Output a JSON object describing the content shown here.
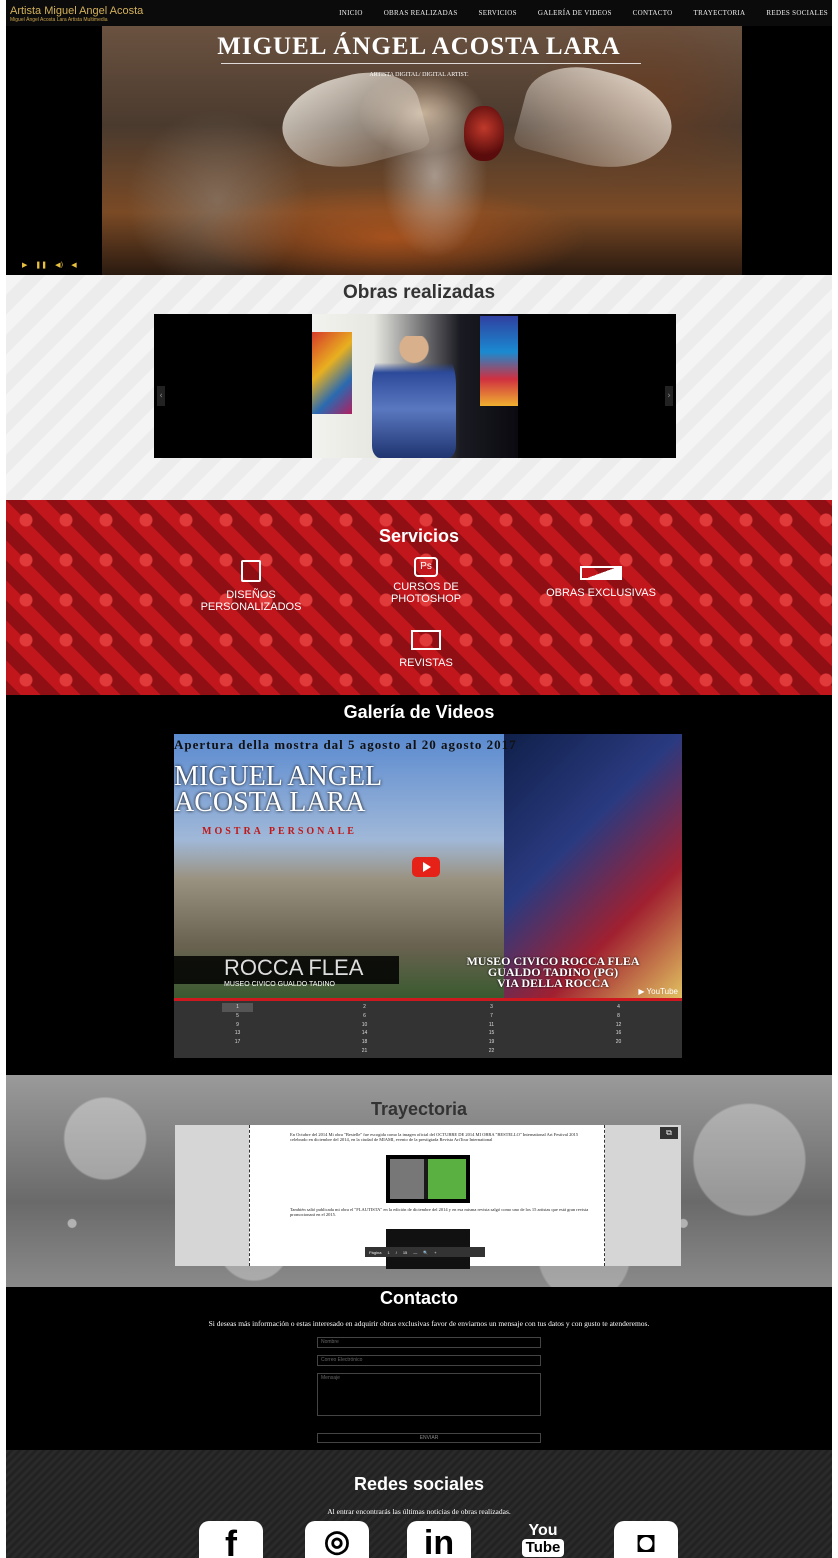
{
  "header": {
    "brand": "Artista Miguel Angel Acosta",
    "brand_sub": "Miguel Ángel Acosta Lara Artista Multimedia",
    "nav": [
      "INICIO",
      "OBRAS REALIZADAS",
      "SERVICIOS",
      "GALERÍA DE VIDEOS",
      "CONTACTO",
      "TRAYECTORIA",
      "REDES SOCIALES"
    ]
  },
  "hero": {
    "title": "MIGUEL ÁNGEL ACOSTA LARA",
    "subtitle": "ARTISTA DIGITAL/ DIGITAL ARTIST.",
    "controls": [
      "▶",
      "❚❚",
      "◀)",
      "◀"
    ]
  },
  "obras": {
    "title": "Obras realizadas",
    "prev": "‹",
    "next": "›"
  },
  "servicios": {
    "title": "Servicios",
    "items": [
      {
        "label": "DISEÑOS PERSONALIZADOS",
        "icon": "book-icon"
      },
      {
        "label": "CURSOS DE PHOTOSHOP",
        "icon": "photoshop-icon",
        "glyph": "Ps"
      },
      {
        "label": "OBRAS EXCLUSIVAS",
        "icon": "image-icon"
      },
      {
        "label": "REVISTAS",
        "icon": "monitor-icon"
      }
    ]
  },
  "videos": {
    "title": "Galería de Videos",
    "banner": "Apertura della mostra dal 5 agosto al 20 agosto 2017",
    "name_line1": "MIGUEL ANGEL",
    "name_line2": "ACOSTA LARA",
    "mostra": "MOSTRA PERSONALE",
    "rocca": "ROCCA FLEA",
    "rocca_sub": "MUSEO CIVICO GUALDO TADINO",
    "museo_line1": "MUSEO CIVICO ROCCA FLEA",
    "museo_line2": "GUALDO TADINO (PG)",
    "museo_line3": "VIA DELLA ROCCA",
    "youtube": "▶ YouTube",
    "pages": [
      "1",
      "2",
      "3",
      "4",
      "5",
      "6",
      "7",
      "8",
      "9",
      "10",
      "11",
      "12",
      "13",
      "14",
      "15",
      "16",
      "17",
      "18",
      "19",
      "20",
      "",
      "21",
      "22",
      ""
    ],
    "selected_page": "1"
  },
  "trayectoria": {
    "title": "Trayectoria",
    "text1": "En Octubre del 2014 Mi obra \"Bestelle\" fue escogida como la imagen oficial del OCTUBRE DE 2014 MI OBRA \"BESTELLO\" International Art Festival 2015 celebrado en diciembre del 2014, en la ciudad de MIAMI, evento de la prestigiada Revista ArtTour International",
    "text2": "También salió publicada mi obra el \"FLAUTISTA\" en la edición de diciembre del 2014 y en esa misma revista salgó como uno de los 15 artistas que está gran revista promocionará en el 2015.",
    "toolbar": [
      "Página",
      "1",
      "/",
      "15",
      "—",
      "🔍",
      "+"
    ],
    "popout": "⧉"
  },
  "contacto": {
    "title": "Contacto",
    "text": "Si deseas más información o estas interesado en adquirir obras exclusivas favor de enviarnos un mensaje con tus datos y con gusto te atenderemos.",
    "name_placeholder": "Nombre",
    "email_placeholder": "Correo Electrónico",
    "message_placeholder": "Mensaje",
    "send": "ENVIAR"
  },
  "redes": {
    "title": "Redes sociales",
    "text": "Al entrar encontrarás las últimas noticias de obras realizadas.",
    "icons": [
      {
        "name": "facebook-icon",
        "glyph": "f"
      },
      {
        "name": "periscope-icon",
        "glyph": "◎"
      },
      {
        "name": "linkedin-icon",
        "glyph": "in"
      },
      {
        "name": "youtube-icon",
        "you": "You",
        "tube": "Tube"
      },
      {
        "name": "instagram-icon",
        "glyph": "◘"
      }
    ]
  },
  "colors": {
    "brand": "#d4b15a",
    "servicios_bg": "#c0161c",
    "youtube_red": "#e62117"
  }
}
